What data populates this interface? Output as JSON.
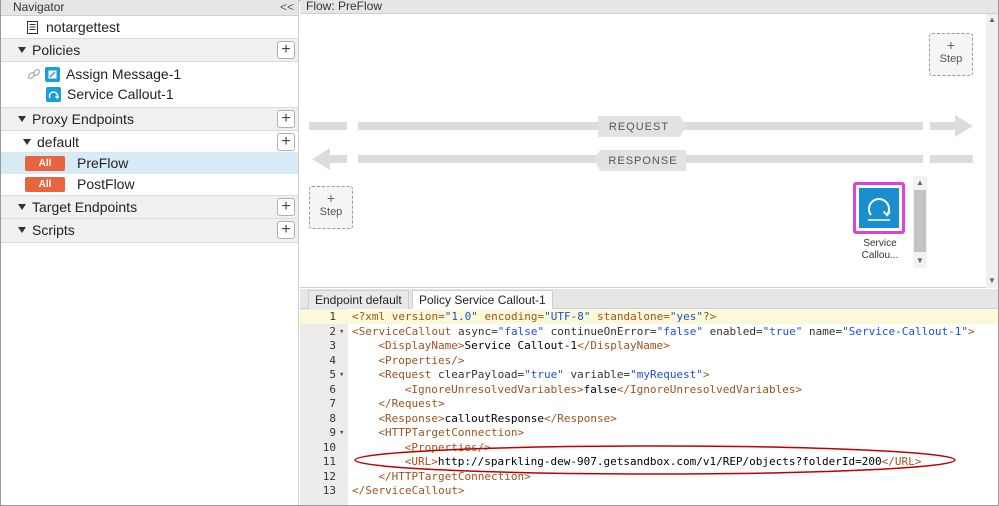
{
  "navigator": {
    "title": "Navigator",
    "collapse_label": "<<",
    "proxy_name": "notargettest",
    "sections": {
      "policies": "Policies",
      "proxy_endpoints": "Proxy Endpoints",
      "target_endpoints": "Target Endpoints",
      "scripts": "Scripts"
    },
    "policies": [
      "Assign Message-1",
      "Service Callout-1"
    ],
    "endpoint_default": "default",
    "flows": [
      {
        "badge": "All",
        "label": "PreFlow",
        "selected": true
      },
      {
        "badge": "All",
        "label": "PostFlow",
        "selected": false
      }
    ]
  },
  "flow": {
    "title": "Flow: PreFlow",
    "step_label": "Step",
    "plus": "+",
    "request_label": "REQUEST",
    "response_label": "RESPONSE",
    "policy_label_line1": "Service",
    "policy_label_line2": "Callou..."
  },
  "tabs": [
    "Endpoint default",
    "Policy Service Callout-1"
  ],
  "code_lines": [
    {
      "n": "1",
      "fold": ""
    },
    {
      "n": "2",
      "fold": "▾"
    },
    {
      "n": "3",
      "fold": ""
    },
    {
      "n": "4",
      "fold": ""
    },
    {
      "n": "5",
      "fold": "▾"
    },
    {
      "n": "6",
      "fold": ""
    },
    {
      "n": "7",
      "fold": ""
    },
    {
      "n": "8",
      "fold": ""
    },
    {
      "n": "9",
      "fold": "▾"
    },
    {
      "n": "10",
      "fold": ""
    },
    {
      "n": "11",
      "fold": ""
    },
    {
      "n": "12",
      "fold": ""
    },
    {
      "n": "13",
      "fold": ""
    }
  ],
  "code": {
    "l1": [
      "<?xml version=",
      "\"1.0\"",
      " encoding=",
      "\"UTF-8\"",
      " standalone=",
      "\"yes\"",
      "?>"
    ],
    "l2": [
      "<ServiceCallout",
      " async=",
      "\"false\"",
      " continueOnError=",
      "\"false\"",
      " enabled=",
      "\"true\"",
      " name=",
      "\"Service-Callout-1\"",
      ">"
    ],
    "l3": [
      "<DisplayName>",
      "Service Callout-1",
      "</DisplayName>"
    ],
    "l4": [
      "<Properties/>"
    ],
    "l5": [
      "<Request",
      " clearPayload=",
      "\"true\"",
      " variable=",
      "\"myRequest\"",
      ">"
    ],
    "l6": [
      "<IgnoreUnresolvedVariables>",
      "false",
      "</IgnoreUnresolvedVariables>"
    ],
    "l7": [
      "</Request>"
    ],
    "l8": [
      "<Response>",
      "calloutResponse",
      "</Response>"
    ],
    "l9": [
      "<HTTPTargetConnection>"
    ],
    "l10": [
      "<Properties/>"
    ],
    "l11": [
      "<URL>",
      "http://sparkling-dew-907.getsandbox.com/v1/REP/objects?folderId=200",
      "</URL>"
    ],
    "l12": [
      "</HTTPTargetConnection>"
    ],
    "l13": [
      "</ServiceCallout>"
    ]
  },
  "colors": {
    "accent_badge": "#e8643c",
    "selection": "#d6ebf5",
    "policy_highlight": "#e040e0",
    "policy_icon": "#1a8fd0",
    "annotation": "#c00000"
  }
}
